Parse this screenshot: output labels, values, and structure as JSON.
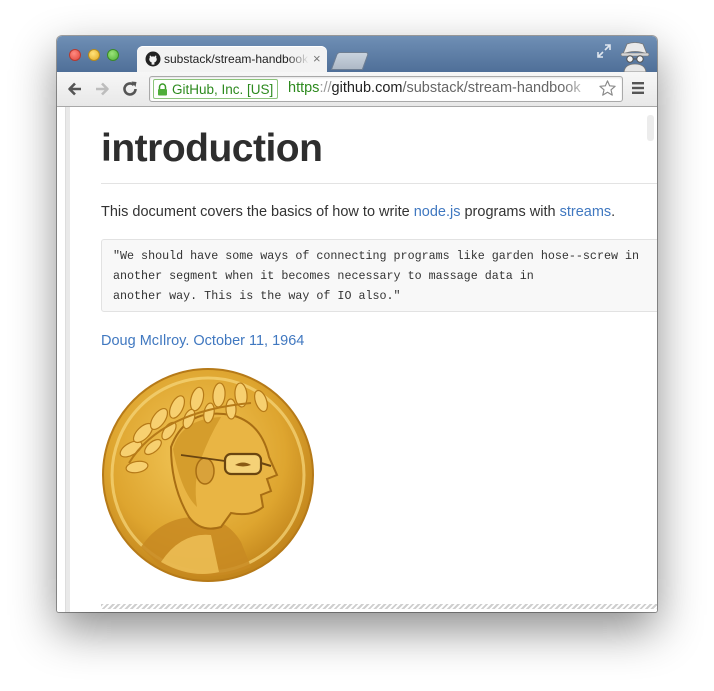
{
  "browser": {
    "tab_title": "substack/stream-handbook",
    "tab_close": "×",
    "ev_label": "GitHub, Inc. [US]",
    "url": {
      "scheme": "https",
      "separator": "://",
      "host": "github.com",
      "path": "/substack/stream-handbook"
    },
    "colors": {
      "tabstrip": "#5a7aa3",
      "secure_green": "#2d8a1e",
      "link": "#4078c0"
    }
  },
  "page": {
    "title": "introduction",
    "intro": {
      "prefix": "This document covers the basics of how to write ",
      "link1": "node.js",
      "middle": " programs with ",
      "link2": "streams",
      "suffix": "."
    },
    "quote_lines": [
      "\"We should have some ways of connecting programs like garden hose--screw in",
      "another segment when it becomes necessary to massage data in",
      "another way. This is the way of IO also.\""
    ],
    "attribution": "Doug McIlroy. October 11, 1964"
  },
  "icons": [
    "github-icon",
    "back-arrow-icon",
    "forward-arrow-icon",
    "reload-icon",
    "lock-icon",
    "star-icon",
    "menu-icon",
    "fullscreen-icon",
    "incognito-icon",
    "coin-portrait-image"
  ]
}
